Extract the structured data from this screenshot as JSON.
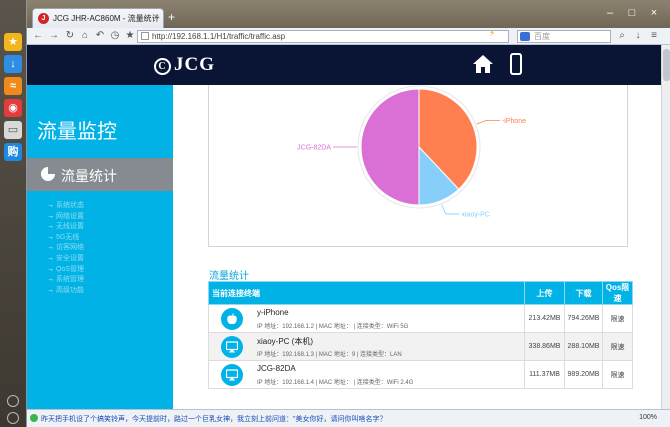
{
  "browser": {
    "tab_title": "JCG JHR-AC860M - 流量统计",
    "url": "http://192.168.1.1/H1/traffic/traffic.asp",
    "search_placeholder": "百度",
    "status_text": "昨天把手机设了个搞笑铃声，今天提前时，路过一个巨乳女神，我立刻上前问道：\"美女你好，请问你叫啥名字？",
    "zoom": "100%"
  },
  "site": {
    "logo": "JCG"
  },
  "sidebar": {
    "title": "流量监控",
    "active": "流量统计",
    "items": [
      "系统状态",
      "网络设置",
      "无线设置",
      "5G无线",
      "访客网络",
      "安全设置",
      "QoS管理",
      "系统管理",
      "高级功能"
    ]
  },
  "chart_data": {
    "type": "pie",
    "series": [
      {
        "name": "-iPhone",
        "value": 38,
        "color": "#ff7f50"
      },
      {
        "name": "xiaoy-PC",
        "value": 12,
        "color": "#87cefa"
      },
      {
        "name": "JCG-82DA",
        "value": 50,
        "color": "#da70d6"
      }
    ]
  },
  "section_title": "流量统计",
  "table": {
    "headers": [
      "当前连接终端",
      "上传",
      "下载",
      "Qos限速"
    ],
    "rows": [
      {
        "name": "y-iPhone",
        "info": "IP 地址：192.168.1.2 | MAC 地址：                    | 连接类型：WiFi 5G",
        "up": "213.42MB",
        "down": "794.26MB",
        "qos": "限速",
        "icon": "apple-icon"
      },
      {
        "name": "xiaoy-PC (本机)",
        "info": "IP 地址：192.168.1.3 | MAC 地址：9                   | 连接类型：LAN",
        "up": "338.86MB",
        "down": "288.10MB",
        "qos": "限速",
        "icon": "monitor-icon"
      },
      {
        "name": "JCG-82DA",
        "info": "IP 地址：192.168.1.4 | MAC 地址：                    | 连接类型：WiFi 2.4G",
        "up": "111.37MB",
        "down": "989.20MB",
        "qos": "限速",
        "icon": "monitor-icon"
      }
    ]
  }
}
